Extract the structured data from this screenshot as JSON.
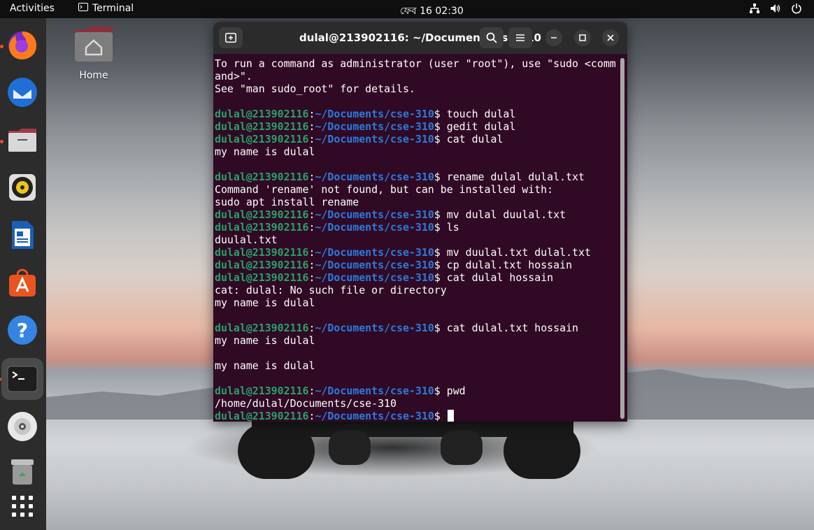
{
  "topbar": {
    "activities": "Activities",
    "app_name": "Terminal",
    "clock": "ফেব 16  02:30"
  },
  "desktop": {
    "home_label": "Home"
  },
  "dock": {
    "items": [
      {
        "icon": "firefox-icon",
        "running": true
      },
      {
        "icon": "thunderbird-icon",
        "running": false
      },
      {
        "icon": "files-icon",
        "running": true
      },
      {
        "icon": "rhythmbox-icon",
        "running": false
      },
      {
        "icon": "libreoffice-writer-icon",
        "running": false
      },
      {
        "icon": "app-center-icon",
        "running": false
      },
      {
        "icon": "help-icon",
        "running": false
      },
      {
        "icon": "terminal-icon",
        "running": true
      },
      {
        "icon": "disc-icon",
        "running": false
      },
      {
        "icon": "trash-icon",
        "running": false
      },
      {
        "icon": "show-apps-icon",
        "running": false
      }
    ]
  },
  "terminal": {
    "title": "dulal@213902116: ~/Documents/cse-310",
    "prompt_user": "dulal@213902116",
    "prompt_path": "~/Documents/cse-310",
    "lines": [
      {
        "type": "out",
        "text": "To run a command as administrator (user \"root\"), use \"sudo <comm"
      },
      {
        "type": "out",
        "text": "and>\"."
      },
      {
        "type": "out",
        "text": "See \"man sudo_root\" for details."
      },
      {
        "type": "out",
        "text": ""
      },
      {
        "type": "cmd",
        "text": "touch dulal"
      },
      {
        "type": "cmd",
        "text": "gedit dulal"
      },
      {
        "type": "cmd",
        "text": "cat dulal"
      },
      {
        "type": "out",
        "text": "my name is dulal"
      },
      {
        "type": "out",
        "text": ""
      },
      {
        "type": "cmd",
        "text": "rename dulal dulal.txt"
      },
      {
        "type": "out",
        "text": "Command 'rename' not found, but can be installed with:"
      },
      {
        "type": "out",
        "text": "sudo apt install rename"
      },
      {
        "type": "cmd",
        "text": "mv dulal duulal.txt"
      },
      {
        "type": "cmd",
        "text": "ls"
      },
      {
        "type": "out",
        "text": "duulal.txt"
      },
      {
        "type": "cmd",
        "text": "mv duulal.txt dulal.txt"
      },
      {
        "type": "cmd",
        "text": "cp dulal.txt hossain"
      },
      {
        "type": "cmd",
        "text": "cat dulal hossain"
      },
      {
        "type": "out",
        "text": "cat: dulal: No such file or directory"
      },
      {
        "type": "out",
        "text": "my name is dulal"
      },
      {
        "type": "out",
        "text": ""
      },
      {
        "type": "cmd",
        "text": "cat dulal.txt hossain"
      },
      {
        "type": "out",
        "text": "my name is dulal"
      },
      {
        "type": "out",
        "text": ""
      },
      {
        "type": "out",
        "text": "my name is dulal"
      },
      {
        "type": "out",
        "text": ""
      },
      {
        "type": "cmd",
        "text": "pwd"
      },
      {
        "type": "out",
        "text": "/home/dulal/Documents/cse-310"
      },
      {
        "type": "cmd",
        "text": "",
        "cursor": true
      }
    ]
  }
}
